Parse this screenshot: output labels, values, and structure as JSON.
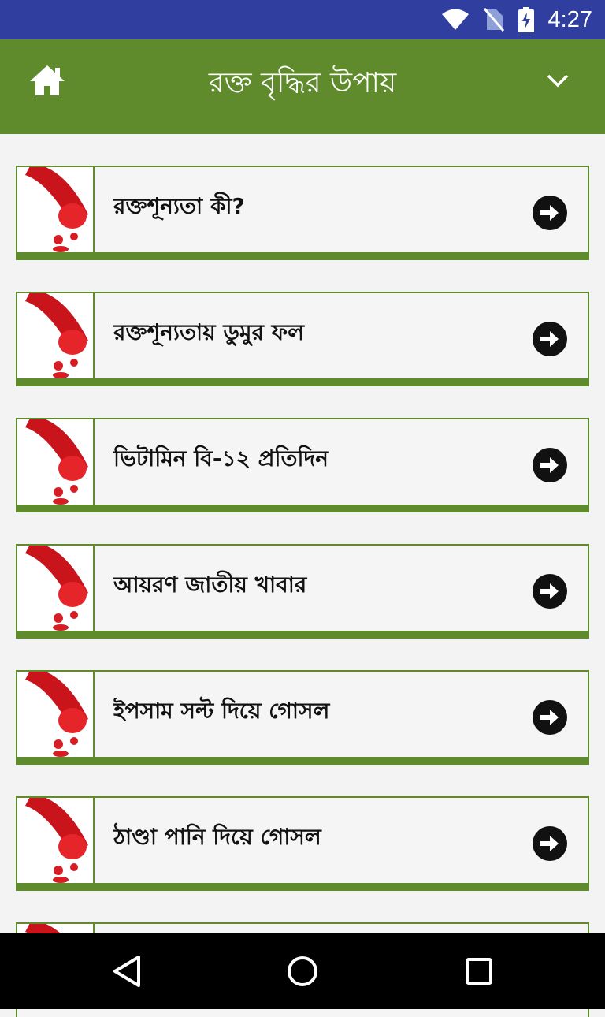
{
  "status_bar": {
    "time": "4:27",
    "icons": [
      "wifi-icon",
      "no-sim-icon",
      "battery-charging-icon"
    ]
  },
  "app_bar": {
    "title": "রক্ত বৃদ্ধির উপায়",
    "home_icon": "home-icon",
    "menu_icon": "chevron-down-icon"
  },
  "list": {
    "items": [
      {
        "label": "রক্তশূন্যতা কী?"
      },
      {
        "label": "রক্তশূন্যতায় ডুমুর ফল"
      },
      {
        "label": "ভিটামিন বি-১২ প্রতিদিন"
      },
      {
        "label": "আয়রণ জাতীয় খাবার"
      },
      {
        "label": "ইপসাম সল্ট দিয়ে গোসল"
      },
      {
        "label": "ঠাণ্ডা পানি দিয়ে গোসল"
      },
      {
        "label": ""
      }
    ]
  },
  "nav_bar": {
    "icons": [
      "back-icon",
      "home-circle-icon",
      "recents-icon"
    ]
  },
  "colors": {
    "status_bar": "#303f9f",
    "app_bar": "#5f8b2c",
    "background": "#f3f3f3",
    "nav_bar": "#000000"
  }
}
